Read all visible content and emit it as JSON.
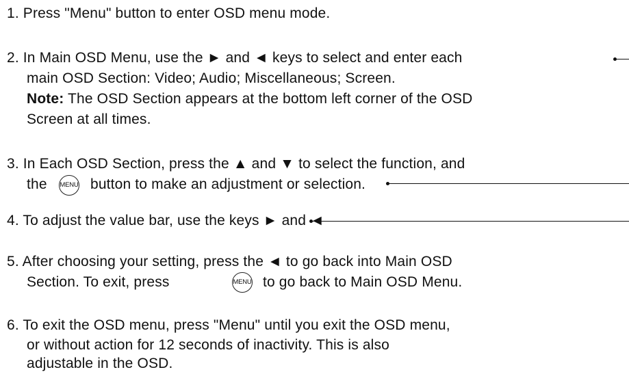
{
  "instructions": {
    "step1": "1. Press \"Menu\" button to enter OSD menu mode.",
    "step2_line1": "2. In Main OSD Menu, use the ► and ◄ keys to select and enter each",
    "step2_line2": "main OSD Section: Video; Audio; Miscellaneous;  Screen.",
    "step2_note_label": "Note:",
    "step2_note_text": " The OSD Section appears at the bottom left corner of the OSD",
    "step2_line4": "Screen at all times.",
    "step3_line1": "3. In Each OSD Section, press the ▲ and ▼ to select the function, and",
    "step3_line2_a": "the",
    "step3_line2_b": "button to make an adjustment or selection.",
    "step4": "4. To adjust the value bar, use the keys  ► and ◄",
    "step5_line1": "5. After choosing your setting, press the ◄ to go back into Main OSD",
    "step5_line2_a": "Section. To exit, press",
    "step5_line2_b": "to go back to Main OSD Menu.",
    "step6_line1": "6. To exit the OSD menu, press \"Menu\" until you exit the OSD menu,",
    "step6_line2": "or without action for 12 seconds of inactivity. This is also",
    "step6_line3": "adjustable in the OSD."
  },
  "menu_button_icon": {
    "name": "menu-button-icon",
    "label": "MENU"
  }
}
